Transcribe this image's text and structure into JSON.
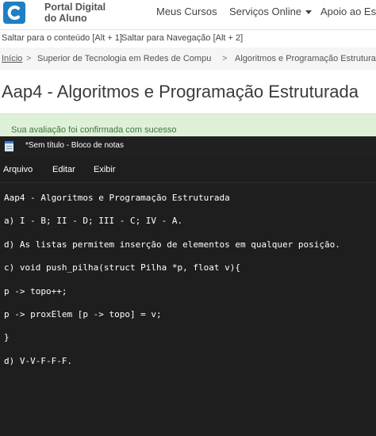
{
  "portal": {
    "brand_line1": "Portal Digital",
    "brand_line2": "do Aluno",
    "nav": {
      "meus_cursos": "Meus Cursos",
      "servicos_online": "Serviços Online",
      "apoio": "Apoio ao Estu"
    },
    "skip_links": {
      "content": "Saltar para o conteúdo [Alt + 1]",
      "navigation": "Saltar para Navegação [Alt + 2]"
    },
    "breadcrumb": {
      "home": "Início",
      "separator": ">",
      "course": "Superior de Tecnologia em Redes de Compu",
      "current": "Algoritmos e Programação Estrutura"
    },
    "page_title": "Aap4 - Algoritmos e Programação Estruturada",
    "alert": "Sua avaliação foi confirmada com sucesso",
    "colors": {
      "logo": "#1e7fc4",
      "alert_bg": "#dff0d8",
      "alert_text": "#3c763d"
    }
  },
  "notepad": {
    "icon": "notepad-icon",
    "title": "*Sem título - Bloco de notas",
    "menu": {
      "arquivo": "Arquivo",
      "editar": "Editar",
      "exibir": "Exibir"
    },
    "lines": [
      "Aap4 - Algoritmos e Programação Estruturada",
      "a) I - B; II - D; III - C; IV - A.",
      "d) As listas permitem inserção de elementos em qualquer posição.",
      "c) void push_pilha(struct Pilha *p, float v){",
      "p -> topo++;",
      "p -> proxElem [p -> topo] = v;",
      "}",
      "d) V-V-F-F-F."
    ],
    "colors": {
      "background": "#1e1e1e",
      "text": "#ffffff"
    }
  }
}
